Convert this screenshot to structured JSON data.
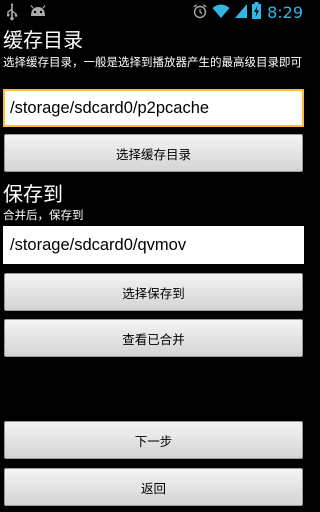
{
  "statusbar": {
    "left_icons": [
      "usb-icon",
      "android-debug-icon"
    ],
    "right_icons": [
      "alarm-icon",
      "wifi-icon",
      "signal-icon",
      "battery-charging-icon"
    ],
    "time": "8:29",
    "time_color": "#33b5e5"
  },
  "cache": {
    "title": "缓存目录",
    "description": "选择缓存目录，一般是选择到播放器产生的最高级目录即可",
    "path_value": "/storage/sdcard0/p2pcache",
    "select_button": "选择缓存目录"
  },
  "save": {
    "title": "保存到",
    "description": "合并后，保存到",
    "path_value": "/storage/sdcard0/qvmov",
    "select_button": "选择保存到",
    "view_merged_button": "查看已合并"
  },
  "actions": {
    "next_button": "下一步",
    "back_button": "返回"
  },
  "colors": {
    "focus_border": "#ffbb33",
    "background": "#000000"
  }
}
